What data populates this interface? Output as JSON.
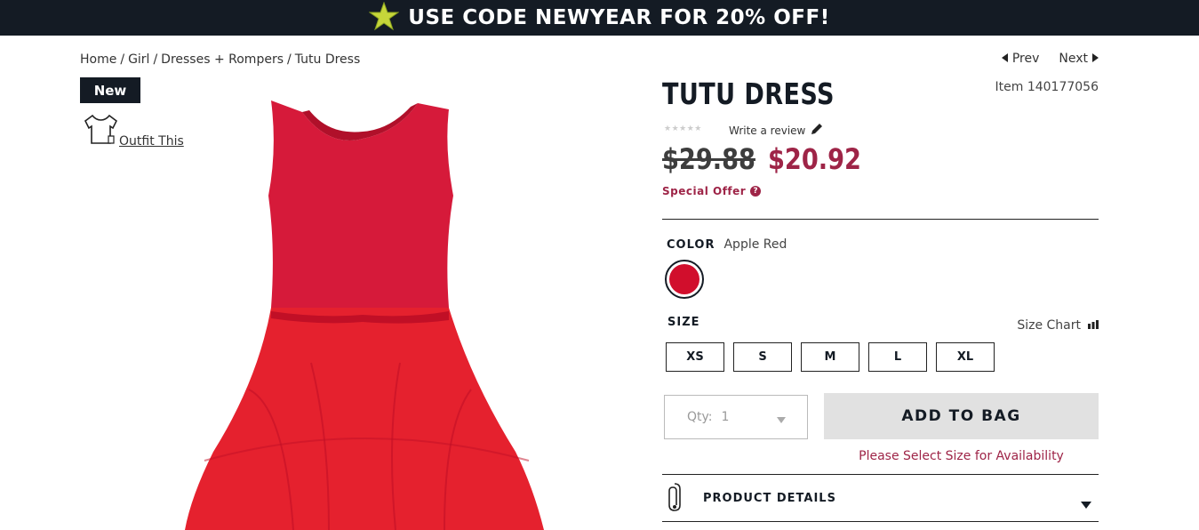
{
  "banner": {
    "text": "USE CODE NEWYEAR FOR 20% OFF!",
    "icon": "star-icon"
  },
  "breadcrumb": [
    "Home",
    "Girl",
    "Dresses + Rompers",
    "Tutu Dress"
  ],
  "badge": "New",
  "outfit_label": "Outfit This",
  "nav": {
    "prev": "Prev",
    "next": "Next"
  },
  "item_number": "Item 140177056",
  "product": {
    "title": "TUTU DRESS",
    "stars": "★★★★★",
    "review_label": "Write a review",
    "old_price": "$29.88",
    "new_price": "$20.92",
    "special_offer": "Special Offer",
    "special_icon": "?"
  },
  "color": {
    "label": "COLOR",
    "value": "Apple Red",
    "swatch_hex": "#d10e2c"
  },
  "size": {
    "label": "SIZE",
    "chart_label": "Size Chart",
    "options": [
      "XS",
      "S",
      "M",
      "L",
      "XL"
    ]
  },
  "qty": {
    "label": "Qty:",
    "value": "1"
  },
  "add_to_bag": "ADD TO BAG",
  "availability": "Please Select Size for Availability",
  "details_label": "PRODUCT DETAILS",
  "colors": {
    "accent": "#9e2447",
    "dark": "#141b24",
    "star": "#c6d63a",
    "dress": "#d10e2c"
  }
}
